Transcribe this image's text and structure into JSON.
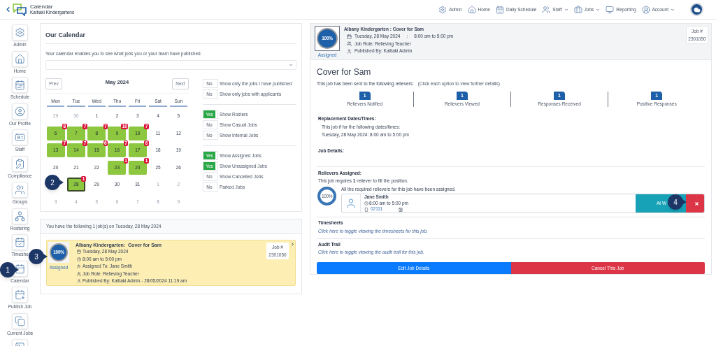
{
  "header": {
    "title": "Calendar",
    "subtitle": "Kaitiaki Kindergartens",
    "nav": [
      {
        "label": "Admin",
        "dropdown": false
      },
      {
        "label": "Home",
        "dropdown": false
      },
      {
        "label": "Daily Schedule",
        "dropdown": false
      },
      {
        "label": "Staff",
        "dropdown": true
      },
      {
        "label": "Jobs",
        "dropdown": true
      },
      {
        "label": "Reporting",
        "dropdown": false
      },
      {
        "label": "Account",
        "dropdown": true
      }
    ]
  },
  "sidebar": {
    "items": [
      {
        "label": "Admin"
      },
      {
        "label": "Home"
      },
      {
        "label": "Schedule"
      },
      {
        "label": "Our Profile"
      },
      {
        "label": "Staff"
      },
      {
        "label": "Compliance"
      },
      {
        "label": "Groups"
      },
      {
        "label": "Rostering"
      },
      {
        "label": "Timeshe"
      },
      {
        "label": "Calendar"
      },
      {
        "label": "Publish Job"
      },
      {
        "label": "Current Jobs"
      }
    ]
  },
  "calendar": {
    "title": "Our Calendar",
    "description": "Your calendar enables you to see what jobs you or your team have published.",
    "prev": "Prev",
    "next": "Next",
    "month": "May 2024",
    "weekdays": [
      "Mon",
      "Tue",
      "Wed",
      "Thu",
      "Fri",
      "Sat",
      "Sun"
    ],
    "weeks": [
      [
        {
          "day": "29",
          "kind": "outside",
          "selected": false
        },
        {
          "day": "30",
          "kind": "outside",
          "selected": false
        },
        {
          "day": "1",
          "kind": "plain",
          "selected": false
        },
        {
          "day": "2",
          "kind": "plain",
          "selected": false
        },
        {
          "day": "3",
          "kind": "plain",
          "selected": false
        },
        {
          "day": "4",
          "kind": "plain",
          "selected": false
        },
        {
          "day": "5",
          "kind": "plain",
          "selected": false
        }
      ],
      [
        {
          "day": "6",
          "kind": "job",
          "badge": "8",
          "selected": false
        },
        {
          "day": "7",
          "kind": "job",
          "badge": "7",
          "selected": false
        },
        {
          "day": "8",
          "kind": "job",
          "badge": "7",
          "selected": false
        },
        {
          "day": "9",
          "kind": "job",
          "badge": "10",
          "selected": false
        },
        {
          "day": "10",
          "kind": "job",
          "badge": "7",
          "selected": false
        },
        {
          "day": "11",
          "kind": "plain",
          "selected": false
        },
        {
          "day": "12",
          "kind": "plain",
          "selected": false
        }
      ],
      [
        {
          "day": "13",
          "kind": "job",
          "badge": "7",
          "selected": false
        },
        {
          "day": "14",
          "kind": "job",
          "badge": "7",
          "selected": false
        },
        {
          "day": "15",
          "kind": "job",
          "badge": "6",
          "selected": false
        },
        {
          "day": "16",
          "kind": "job",
          "badge": "7",
          "selected": false
        },
        {
          "day": "17",
          "kind": "job",
          "badge": "6",
          "selected": false
        },
        {
          "day": "18",
          "kind": "plain",
          "selected": false
        },
        {
          "day": "19",
          "kind": "plain",
          "selected": false
        }
      ],
      [
        {
          "day": "20",
          "kind": "plain",
          "selected": false
        },
        {
          "day": "21",
          "kind": "plain",
          "selected": false
        },
        {
          "day": "22",
          "kind": "plain",
          "selected": false
        },
        {
          "day": "23",
          "kind": "job",
          "badge": "1",
          "selected": false
        },
        {
          "day": "24",
          "kind": "job",
          "badge": "1",
          "selected": false
        },
        {
          "day": "25",
          "kind": "plain",
          "selected": false
        },
        {
          "day": "26",
          "kind": "plain",
          "selected": false
        }
      ],
      [
        {
          "day": "28",
          "kind": "job",
          "badge": "1",
          "selected": true
        },
        {
          "day": "29",
          "kind": "plain",
          "selected": false
        },
        {
          "day": "30",
          "kind": "plain",
          "selected": false
        },
        {
          "day": "31",
          "kind": "plain",
          "selected": false
        },
        {
          "day": "1",
          "kind": "outside",
          "selected": false
        },
        {
          "day": "2",
          "kind": "outside",
          "selected": false
        }
      ],
      [
        {
          "day": "3",
          "kind": "outside",
          "selected": false
        },
        {
          "day": "4",
          "kind": "outside",
          "selected": false
        },
        {
          "day": "5",
          "kind": "outside",
          "selected": false
        },
        {
          "day": "6",
          "kind": "outside",
          "selected": false
        },
        {
          "day": "7",
          "kind": "outside",
          "selected": false
        },
        {
          "day": "8",
          "kind": "outside",
          "selected": false
        },
        {
          "day": "9",
          "kind": "outside",
          "selected": false
        }
      ]
    ],
    "filter_groups": [
      [
        {
          "label": "Show only the jobs I have published",
          "on": false,
          "text": "No"
        },
        {
          "label": "Show only jobs with applicants",
          "on": false,
          "text": "No"
        }
      ],
      [
        {
          "label": "Show Rosters",
          "on": true,
          "text": "Yes"
        },
        {
          "label": "Show Casual Jobs",
          "on": false,
          "text": "No"
        },
        {
          "label": "Show Internal Jobs",
          "on": false,
          "text": "No"
        }
      ],
      [
        {
          "label": "Show Assigned Jobs",
          "on": true,
          "text": "Yes"
        },
        {
          "label": "Show Unassigned Jobs",
          "on": true,
          "text": "Yes"
        },
        {
          "label": "Show Cancelled Jobs",
          "on": false,
          "text": "No"
        },
        {
          "label": "Parked Jobs",
          "on": false,
          "text": "No"
        }
      ]
    ]
  },
  "jobs_list": {
    "header": "You have the following 1 job(s) on Tuesday, 28 May 2024",
    "job": {
      "progress": "100%",
      "status": "Assigned",
      "title": "Albany Kindergarten:  Cover for Sam",
      "date": "Tuesday, 28 May 2024",
      "time": "8:00 am to 5:00 pm",
      "assigned_to": "Assigned To: Jane Smith",
      "role": "Job Role: Relieving Teacher",
      "published": "Published By: Kaitiaki Admin - 28/05/2024 11:19 am",
      "job_label": "Job #",
      "job_number": "2301050"
    }
  },
  "job_detail": {
    "progress": "100%",
    "status": "Assigned",
    "title": "Albany Kindergarten : Cover for Sam",
    "date": "Tuesday, 28 May 2024",
    "separator": ":",
    "time": "8:00 am to 5:00 pm",
    "role": "Job Role: Relieving Teacher",
    "published": "Published By: Kaitiaki Admin",
    "job_label": "Job #",
    "job_number": "2301050",
    "heading": "Cover for Sam",
    "sent": "This job has been sent to the following relievers:",
    "hint": "(Click each option to view further details)",
    "stats": [
      {
        "count": "1",
        "label": "Relievers Notified"
      },
      {
        "count": "1",
        "label": "Relievers Viewed"
      },
      {
        "count": "1",
        "label": "Responses Received"
      },
      {
        "count": "1",
        "label": "Positive Responses"
      }
    ],
    "replacement": {
      "title": "Replacement Dates/Times:",
      "lines": [
        "This job if for the following dates/times:",
        "Tuesday, 28 May 2024: 8:00 am to 5:00 pm"
      ]
    },
    "job_details": "Job Details:",
    "relievers": {
      "title": "Relievers Assigned:",
      "requirement": "This job requires **1** reliever to fill the position.",
      "progress": "100%",
      "message": "All the required relievers for this job have been assigned.",
      "reliever": {
        "name": "Jane Smith",
        "time": "8:00 am to 5:00 pm",
        "phone": "02111",
        "status": "At W"
      }
    },
    "sections": [
      {
        "title": "Timesheets",
        "link": "Click here to toggle viewing the timesheets for this job."
      },
      {
        "title": "Audit Trail",
        "link": "Click here to toggle viewing the audit trail for this job."
      }
    ],
    "buttons": [
      {
        "label": "Edit Job Details",
        "kind": "primary"
      },
      {
        "label": "Cancel This Job",
        "kind": "danger"
      }
    ]
  },
  "callouts": [
    "1",
    "2",
    "3",
    "4"
  ]
}
